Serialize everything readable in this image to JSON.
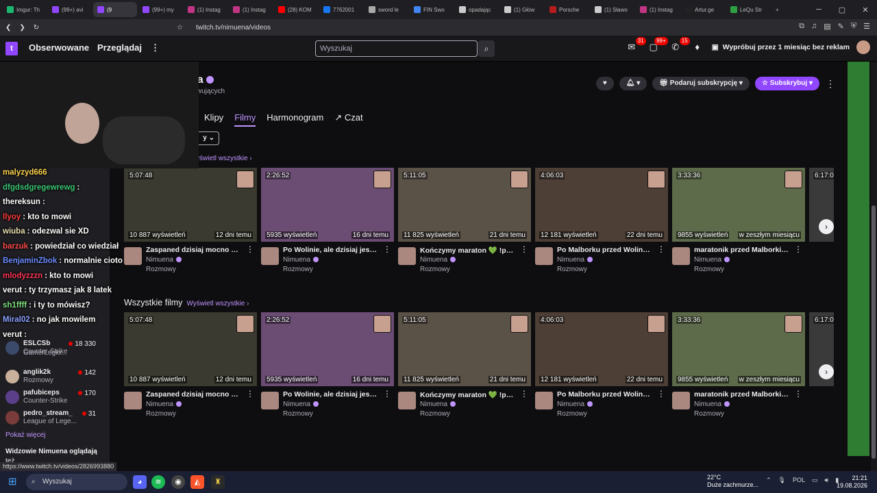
{
  "browser": {
    "tabs": [
      "Imgur: Th",
      "(99+) avi",
      "(9",
      "(99+) my",
      "(1) Instag",
      "(1) Instag",
      "(28) KOM",
      "7762001",
      "sword le",
      "FIN Swo",
      "opadając",
      "(1) Głów",
      "Porsche",
      "(1) Sławo",
      "(1) Instag",
      "Artur.ge",
      "LeQu Str"
    ],
    "url": "twitch.tv/nimuena/videos",
    "status_url": "https://www.twitch.tv/videos/2826993880"
  },
  "topnav": {
    "logo": "t",
    "following": "Obserwowane",
    "browse": "Przeglądaj",
    "search_placeholder": "Wyszukaj",
    "badges": [
      "31",
      "99+",
      "15"
    ],
    "turbo": "Wypróbuj przez 1 miesiąc bez reklam"
  },
  "channel": {
    "name": "na",
    "followers": "erwujących",
    "tabs": [
      "Klipy",
      "Filmy",
      "Harmonogram",
      "Czat"
    ],
    "active_tab": "Filmy",
    "gift_label": "Podaruj subskrypcję",
    "sub_label": "Subskrybuj",
    "sort_label": "y"
  },
  "sections": {
    "view_all_top": "yświetl wszystkie",
    "all_videos": "Wszystkie filmy",
    "view_all": "Wyświetl wszystkie"
  },
  "videos": [
    {
      "length": "5:07:48",
      "views": "10 887 wyświetleń",
      "date": "12 dni temu",
      "title": "Zaspaned dzisiaj mocno xdd ...",
      "channel": "Nimuena",
      "category": "Rozmowy",
      "color": "#3a3a30"
    },
    {
      "length": "2:26:52",
      "views": "5935 wyświetleń",
      "date": "16 dni temu",
      "title": "Po Wolinie, ale dzisiaj jeszcze j...",
      "channel": "Nimuena",
      "category": "Rozmowy",
      "color": "#6b4c73"
    },
    {
      "length": "5:11:05",
      "views": "11 825 wyświetleń",
      "date": "21 dni temu",
      "title": "Kończymy maraton 💚 !psibuf...",
      "channel": "Nimuena",
      "category": "Rozmowy",
      "color": "#5a5147"
    },
    {
      "length": "4:06:03",
      "views": "12 181 wyświetleń",
      "date": "22 dni temu",
      "title": "Po Malborku przed Wolinem ...",
      "channel": "Nimuena",
      "category": "Rozmowy",
      "color": "#4d3e36"
    },
    {
      "length": "3:33:36",
      "views": "9855 wyświetleń",
      "date": "w zeszłym miesiącu",
      "title": "maratonik przed Malborkiem ...",
      "channel": "Nimuena",
      "category": "Rozmowy",
      "color": "#5d6b4a"
    }
  ],
  "partial_length": "6:17:0",
  "sidebar": {
    "channels": [
      {
        "name": "ESLCSb",
        "game": "Counter-Strike",
        "viewers": "18 330"
      },
      {
        "name": "",
        "game": "GamerLegio...",
        "viewers": ""
      },
      {
        "name": "anglik2k",
        "game": "Rozmowy",
        "viewers": "142"
      },
      {
        "name": "pafubiceps",
        "game": "Counter-Strike",
        "viewers": "170"
      },
      {
        "name": "pedro_stream_",
        "game": "League of Lege...",
        "viewers": "31"
      }
    ],
    "show_more": "Pokaż więcej",
    "also_watch": "Widzowie Nimuena oglądają",
    "also_watch_cont": "też"
  },
  "chat": [
    {
      "user": "malyzyd666",
      "msg": "",
      "color": "#ffd24d"
    },
    {
      "user": "dfgdsdgregewrewg",
      "msg": ":",
      "color": "#3cc774"
    },
    {
      "user": "thereksun",
      "msg": ":",
      "color": "#ffffff"
    },
    {
      "user": "Ilyoy",
      "msg": ": kto to mowi",
      "color": "#ff3b3b"
    },
    {
      "user": "wiuba",
      "msg": ": odezwal sie XD",
      "color": "#e8e0b0"
    },
    {
      "user": "barzuk",
      "msg": ": powiedział co wiedział",
      "color": "#ff4a4a"
    },
    {
      "user": "BenjaminZbok",
      "msg": ": normalnie cioto",
      "color": "#6c8cff"
    },
    {
      "user": "mlodyzzzn",
      "msg": ": kto to mowi",
      "color": "#ff3355"
    },
    {
      "user": "verut",
      "msg": ": ty trzymasz jak 8 latek",
      "color": "#ffffff"
    },
    {
      "user": "sh1ffff",
      "msg": ": i ty to mówisz?",
      "color": "#7fe07f"
    },
    {
      "user": "Miral02",
      "msg": ": no jak mowilem",
      "color": "#8aa0ff"
    },
    {
      "user": "verut",
      "msg": ":",
      "color": "#ffffff"
    }
  ],
  "taskbar": {
    "search": "Wyszukaj",
    "weather_temp": "22°C",
    "weather_desc": "Duże zachmurze...",
    "lang": "POL",
    "time": "21:21",
    "date": "19.08.2026"
  },
  "colors": {
    "brand": "#9147ff",
    "accent": "#bf94ff",
    "live": "#eb0400"
  }
}
